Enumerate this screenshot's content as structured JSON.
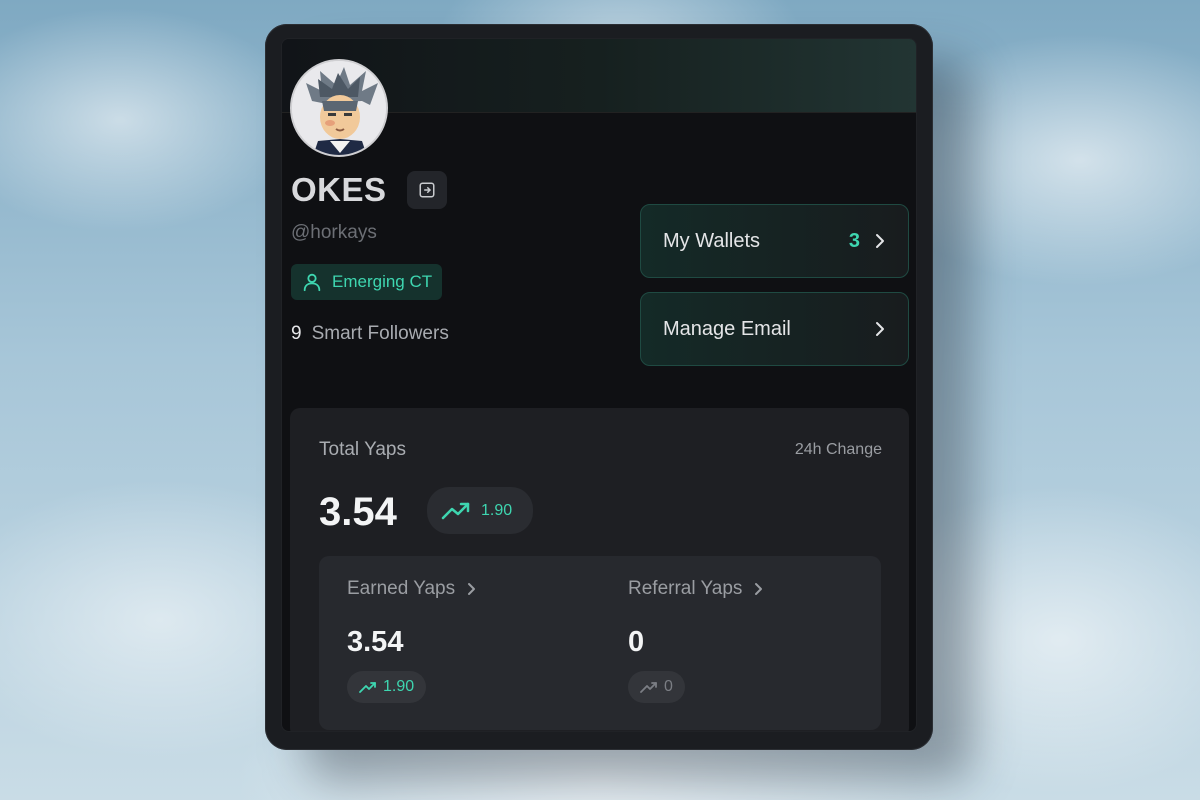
{
  "profile": {
    "name": "OKES",
    "handle": "@horkays",
    "tier": "Emerging CT",
    "smart_followers_count": "9",
    "smart_followers_label": "Smart Followers"
  },
  "actions": {
    "wallets_label": "My Wallets",
    "wallets_count": "3",
    "email_label": "Manage Email"
  },
  "stats": {
    "title": "Total Yaps",
    "change_label": "24h Change",
    "total": "3.54",
    "total_change": "1.90",
    "earned": {
      "label": "Earned Yaps",
      "value": "3.54",
      "change": "1.90"
    },
    "referral": {
      "label": "Referral Yaps",
      "value": "0",
      "change": "0"
    }
  },
  "colors": {
    "accent": "#3ed6b0",
    "background": "#0f1013",
    "panel": "#1e1f23"
  },
  "icons": [
    "logout-icon",
    "user-icon",
    "chevron-right-icon",
    "trend-up-icon"
  ]
}
